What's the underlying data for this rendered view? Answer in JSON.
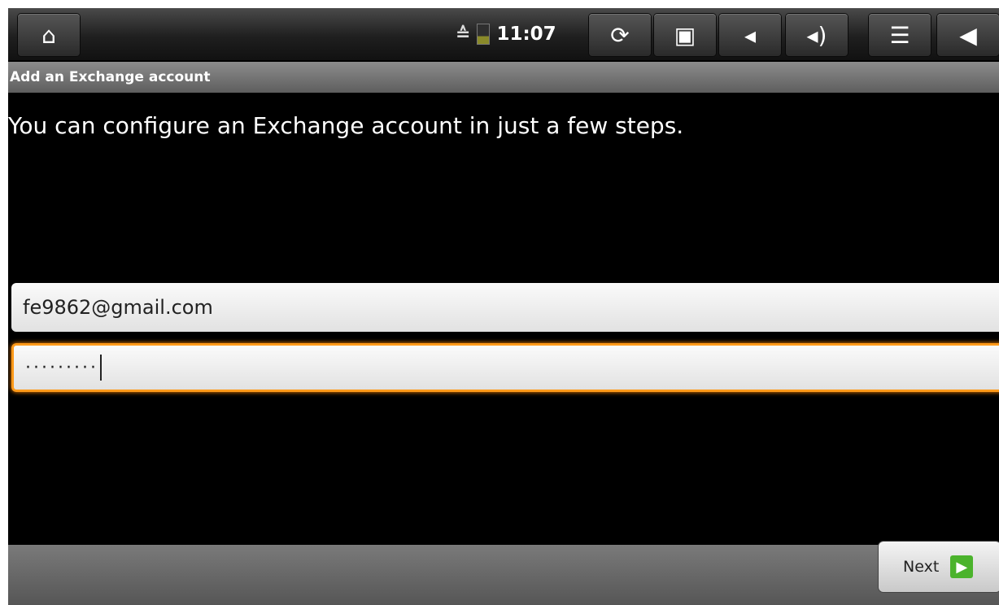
{
  "status_bar": {
    "time": "11:07",
    "icons": [
      "home-icon",
      "wifi-icon",
      "battery-icon",
      "refresh-icon",
      "camera-icon",
      "volume-down-icon",
      "volume-up-icon",
      "menu-icon",
      "back-icon"
    ]
  },
  "title_bar": {
    "title": "Add an Exchange account"
  },
  "instructions": "You can configure an Exchange account in just a few steps.",
  "form": {
    "email_value": "fe9862@gmail.com",
    "password_masked": "·········"
  },
  "footer": {
    "next_label": "Next"
  },
  "colors": {
    "accent_focus": "#ff9a1a",
    "next_icon": "#4bb32c"
  }
}
